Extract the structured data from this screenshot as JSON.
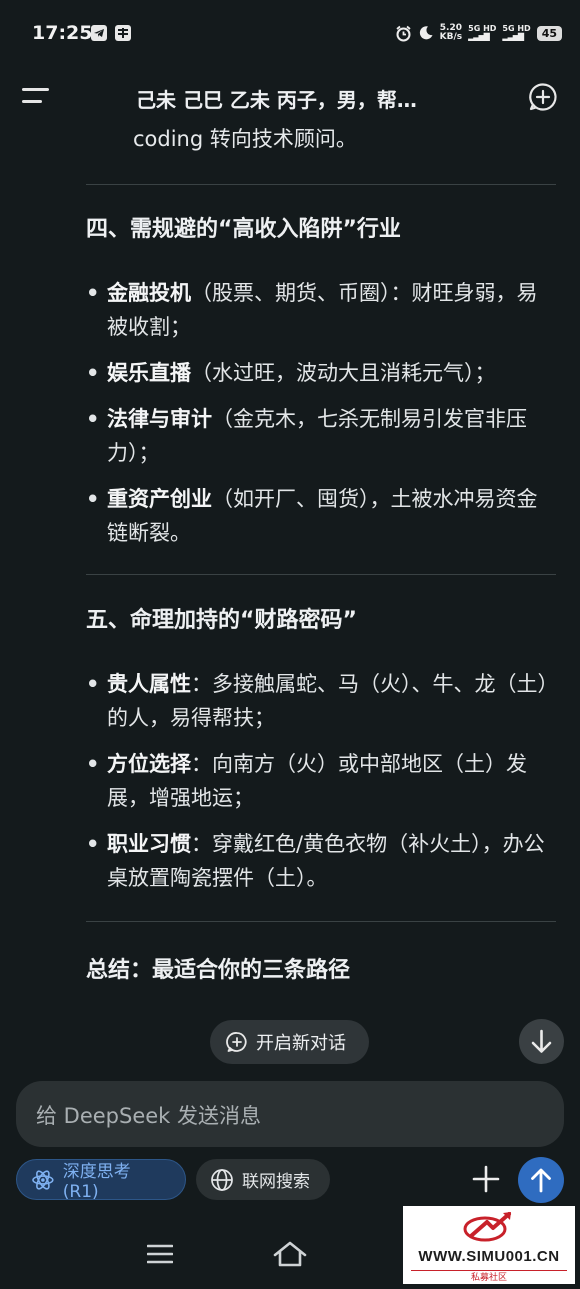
{
  "status_bar": {
    "time": "17:25",
    "net_speed_value": "5.20",
    "net_speed_unit": "KB/s",
    "sim1": "5G HD",
    "sim2": "5G HD",
    "battery": "45"
  },
  "header": {
    "title": "己未 己巳 乙未 丙子，男，帮…"
  },
  "content": {
    "intro_text": "coding 转向技术顾问。",
    "section4": {
      "heading": "四、需规避的“高收入陷阱”行业",
      "items": [
        {
          "bold": "金融投机",
          "text": "（股票、期货、币圈）：财旺身弱，易被收割；"
        },
        {
          "bold": "娱乐直播",
          "text": "（水过旺，波动大且消耗元气）；"
        },
        {
          "bold": "法律与审计",
          "text": "（金克木，七杀无制易引发官非压力）；"
        },
        {
          "bold": "重资产创业",
          "text": "（如开厂、囤货），土被水冲易资金链断裂。"
        }
      ]
    },
    "section5": {
      "heading": "五、命理加持的“财路密码”",
      "items": [
        {
          "bold": "贵人属性",
          "text": "：多接触属蛇、马（火）、牛、龙（土）的人，易得帮扶；"
        },
        {
          "bold": "方位选择",
          "text": "：向南方（火）或中部地区（土）发展，增强地运；"
        },
        {
          "bold": "职业习惯",
          "text": "：穿戴红色/黄色衣物（补火土），办公桌放置陶瓷摆件（土）。"
        }
      ]
    },
    "summary_heading": "总结：最适合你的三条路径"
  },
  "floating": {
    "start_new_chat": "开启新对话"
  },
  "composer": {
    "placeholder": "给 DeepSeek 发送消息",
    "deep_think": "深度思考 (R1)",
    "web_search": "联网搜索"
  },
  "watermark": {
    "site": "WWW.SIMU001.CN",
    "sub": "私募社区"
  },
  "colors": {
    "background": "#141a1c",
    "accent_blue": "#2f6cc0",
    "deep_think_text": "#7fb1f1"
  },
  "icons": [
    "menu-icon",
    "new-chat-icon",
    "chat-plus-icon",
    "arrow-down-icon",
    "atom-icon",
    "globe-icon",
    "plus-icon",
    "arrow-up-icon",
    "nav-menu-icon",
    "nav-home-icon"
  ]
}
